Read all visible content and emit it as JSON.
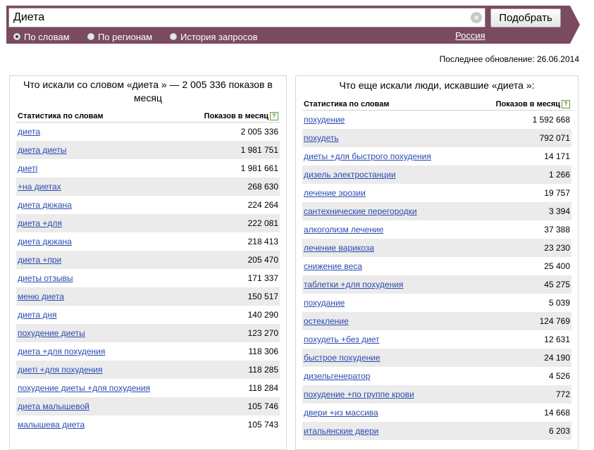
{
  "search": {
    "query": "Диета",
    "button": "Подобрать"
  },
  "tabs": [
    {
      "label": "По словам",
      "checked": true
    },
    {
      "label": "По регионам",
      "checked": false
    },
    {
      "label": "История запросов",
      "checked": false
    }
  ],
  "region": "Россия",
  "updated": "Последнее обновление: 26.06.2014",
  "left": {
    "title": "Что искали со словом «диета » — 2 005 336 показов в месяц",
    "col1": "Статистика по словам",
    "col2": "Показов в месяц",
    "rows": [
      [
        "диета",
        "2 005 336"
      ],
      [
        "диета диеты",
        "1 981 751"
      ],
      [
        "диеті",
        "1 981 661"
      ],
      [
        "+на диетах",
        "268 630"
      ],
      [
        "диета дюкана",
        "224 264"
      ],
      [
        "диета +для",
        "222 081"
      ],
      [
        "диета дюкана",
        "218 413"
      ],
      [
        "диета +при",
        "205 470"
      ],
      [
        "диеты отзывы",
        "171 337"
      ],
      [
        "меню диета",
        "150 517"
      ],
      [
        "диета дня",
        "140 290"
      ],
      [
        "похудение диеты",
        "123 270"
      ],
      [
        "диета +для похудения",
        "118 306"
      ],
      [
        "диеті +для похудения",
        "118 285"
      ],
      [
        "похудение диеты +для похудения",
        "118 284"
      ],
      [
        "диета малышевой",
        "105 746"
      ],
      [
        "малышева диета",
        "105 743"
      ]
    ]
  },
  "right": {
    "title": "Что еще искали люди, искавшие «диета »:",
    "col1": "Статистика по словам",
    "col2": "Показов в месяц",
    "rows": [
      [
        "похудение",
        "1 592 668"
      ],
      [
        "похудеть",
        "792 071"
      ],
      [
        "диеты +для быстрого похудения",
        "14 171"
      ],
      [
        "дизель электростанции",
        "1 266"
      ],
      [
        "лечение эрозии",
        "19 757"
      ],
      [
        "сантехнические перегородки",
        "3 394"
      ],
      [
        "алкоголизм лечение",
        "37 388"
      ],
      [
        "лечение варикоза",
        "23 230"
      ],
      [
        "снижение веса",
        "25 400"
      ],
      [
        "таблетки +для похудения",
        "45 275"
      ],
      [
        "похудание",
        "5 039"
      ],
      [
        "остекление",
        "124 769"
      ],
      [
        "похудеть +без диет",
        "12 631"
      ],
      [
        "быстрое похудение",
        "24 190"
      ],
      [
        "дизельгенератор",
        "4 526"
      ],
      [
        "похудение +по группе крови",
        "772"
      ],
      [
        "двери +из массива",
        "14 668"
      ],
      [
        "итальянские двери",
        "6 203"
      ]
    ]
  }
}
